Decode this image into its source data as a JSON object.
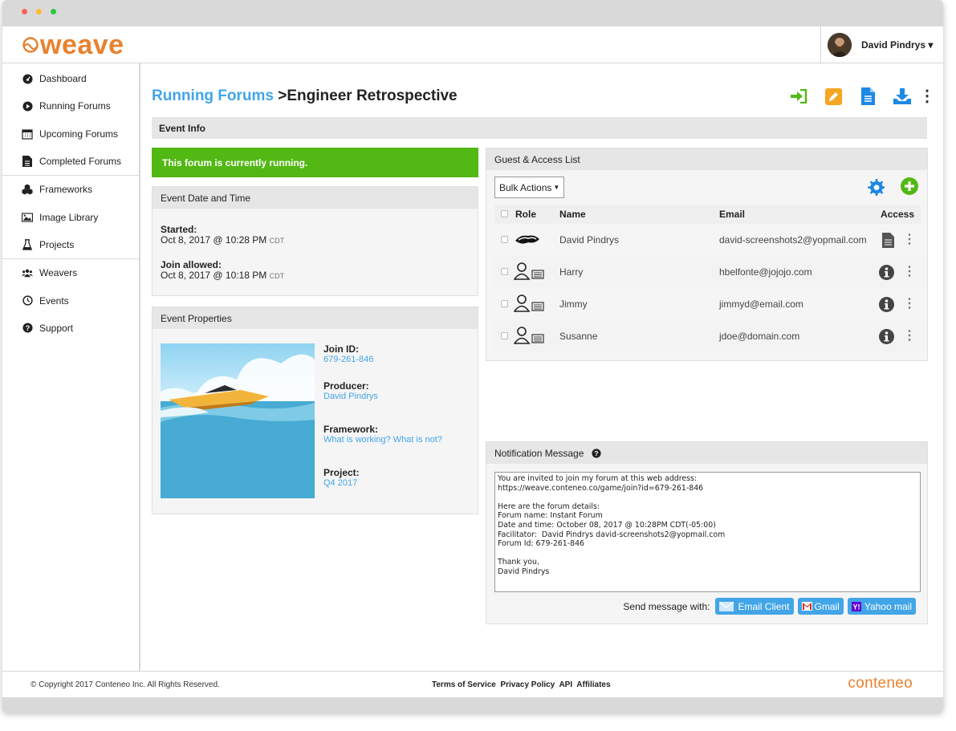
{
  "app": {
    "logo_text": "weave",
    "user_name": "David Pindrys ▾"
  },
  "sidebar": {
    "items": [
      {
        "label": "Dashboard",
        "icon": "dashboard-icon"
      },
      {
        "label": "Running Forums",
        "icon": "play-icon"
      },
      {
        "label": "Upcoming Forums",
        "icon": "calendar-icon"
      },
      {
        "label": "Completed Forums",
        "icon": "document-icon"
      },
      {
        "label": "Frameworks",
        "icon": "cubes-icon"
      },
      {
        "label": "Image Library",
        "icon": "image-icon"
      },
      {
        "label": "Projects",
        "icon": "flask-icon"
      },
      {
        "label": "Weavers",
        "icon": "users-icon"
      },
      {
        "label": "Events",
        "icon": "clock-icon"
      },
      {
        "label": "Support",
        "icon": "question-icon"
      }
    ]
  },
  "breadcrumb": {
    "parent": "Running Forums",
    "separator": ">",
    "current": "Engineer Retrospective"
  },
  "event_info": {
    "title": "Event Info",
    "status": "This forum is currently running.",
    "date_time": {
      "title": "Event Date and Time",
      "started_label": "Started:",
      "started_value": "Oct 8, 2017 @ 10:28 PM",
      "started_tz": "CDT",
      "join_label": "Join allowed:",
      "join_value": "Oct 8, 2017 @ 10:18 PM",
      "join_tz": "CDT"
    },
    "properties": {
      "title": "Event Properties",
      "join_id_label": "Join ID:",
      "join_id": "679-261-846",
      "producer_label": "Producer:",
      "producer": "David Pindrys",
      "framework_label": "Framework:",
      "framework": "What is working? What is not?",
      "project_label": "Project:",
      "project": "Q4 2017"
    }
  },
  "guests": {
    "title": "Guest & Access List",
    "bulk_actions": "Bulk Actions",
    "columns": {
      "role": "Role",
      "name": "Name",
      "email": "Email",
      "access": "Access"
    },
    "rows": [
      {
        "name": "David Pindrys",
        "email": "david-screenshots2@yopmail.com",
        "role": "producer",
        "access": "document"
      },
      {
        "name": "Harry",
        "email": "hbelfonte@jojojo.com",
        "role": "participant",
        "access": "info"
      },
      {
        "name": "Jimmy",
        "email": "jimmyd@email.com",
        "role": "participant",
        "access": "info"
      },
      {
        "name": "Susanne",
        "email": "jdoe@domain.com",
        "role": "participant",
        "access": "info"
      }
    ]
  },
  "notification": {
    "title": "Notification Message",
    "message": "You are invited to join my forum at this web address:\nhttps://weave.conteneo.co/game/join?id=679-261-846\n\nHere are the forum details:\nForum name: Instant Forum\nDate and time: October 08, 2017 @ 10:28PM CDT(-05:00)\nFacilitator:  David Pindrys david-screenshots2@yopmail.com\nForum Id: 679-261-846\n\nThank you,\nDavid Pindrys",
    "send_label": "Send message with:",
    "email_client": "Email Client",
    "gmail": "Gmail",
    "yahoo": "Yahoo mail"
  },
  "footer": {
    "copyright": "© Copyright 2017 Conteneo Inc. All Rights Reserved.",
    "links": [
      "Terms of Service",
      "Privacy Policy",
      "API",
      "Affiliates"
    ],
    "brand": "conteneo"
  },
  "colors": {
    "accent": "#42a5e8",
    "running": "#52b814",
    "brand": "#e8822f",
    "action_green": "#52b814",
    "action_orange": "#f5a623"
  }
}
